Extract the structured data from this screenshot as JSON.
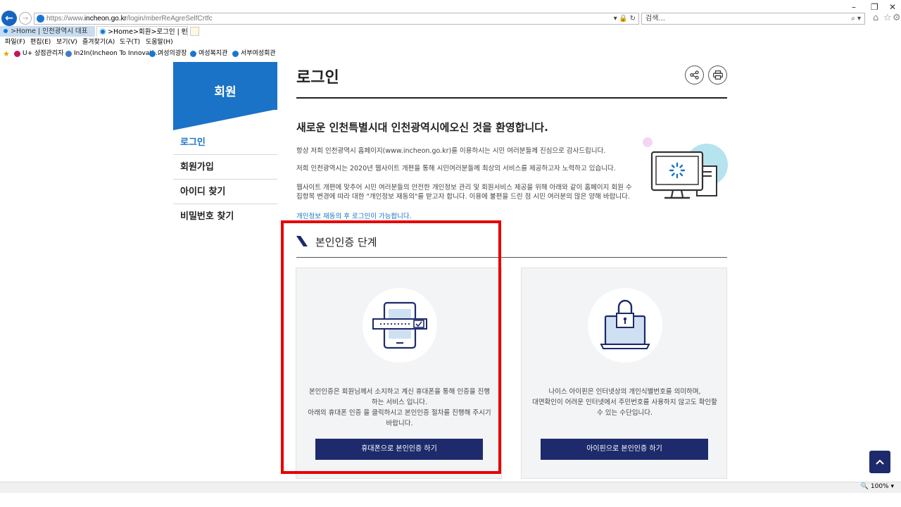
{
  "browser": {
    "url_prefix": "https://www.",
    "url_domain": "incheon.go.kr",
    "url_path": "/login/mberReAgreSelfCrtfc",
    "search_placeholder": "검색...",
    "tabs": [
      {
        "label": ">Home | 인천광역시 대표"
      },
      {
        "label": ">Home>회원>로그인 | 인..."
      }
    ],
    "menu": [
      "파일(F)",
      "편집(E)",
      "보기(V)",
      "즐겨찾기(A)",
      "도구(T)",
      "도움말(H)"
    ],
    "favorites": [
      {
        "label": "U+ 상점관리자",
        "color": "#c2185b"
      },
      {
        "label": "In2In(Incheon To Innovati...",
        "color": "#3f7fbf"
      },
      {
        "label": "여성의광장",
        "color": "#1976d2"
      },
      {
        "label": "여성복지관",
        "color": "#1976d2"
      },
      {
        "label": "서부여성회관",
        "color": "#1976d2"
      }
    ],
    "zoom": "100%"
  },
  "sidebar": {
    "title": "회원",
    "items": [
      {
        "label": "로그인",
        "active": true
      },
      {
        "label": "회원가입"
      },
      {
        "label": "아이디 찾기"
      },
      {
        "label": "비밀번호 찾기"
      }
    ]
  },
  "main": {
    "title": "로그인",
    "welcome": "새로운 인천특별시대 인천광역시에오신 것을 환영합니다.",
    "paragraphs": [
      "항상 저희 인천광역시 홈페이지(www.incheon.go.kr)를 이용하시는 시민 여러분들께 진심으로 감사드립니다.",
      "저희 인천광역시는 2020년 웹사이트 개편을 통해 시민여러분들께 최상의 서비스를 제공하고자 노력하고 있습니다.",
      "웹사이트 개편에 맞추어 시민 여러분들의 안전한 개인정보 관리 및 회원서비스 제공을 위해 아래와 같이 홈페이지 회원 수집항목 변경에 따라 대한 \"개인정보 재동의\"를 받고자 합니다. 이용에 불편을 드린 점 시민 여러분의 많은 양해 바랍니다."
    ],
    "notice": "개인정보 재동의 후 로그인이 가능합니다.",
    "section_title": "본인인증 단계",
    "cards": [
      {
        "desc_line1": "본인인증은 회원님께서 소지하고 계신 휴대폰을 통해 인증을 진행하는 서비스 입니다.",
        "desc_line2": "아래의 휴대폰 인증 을 클릭하시고 본인인증 절차를 진행해 주시기 바랍니다.",
        "button": "휴대폰으로 본인인증 하기"
      },
      {
        "desc_line1": "나이스 아이핀은 인터넷상의 개인식별번호를 의미하며,",
        "desc_line2": "대면확인이 어려운 인터넷에서 주민번호를 사용하지 않고도 확인할 수 있는 수단입니다.",
        "button": "아이핀으로 본인인증 하기"
      }
    ]
  }
}
